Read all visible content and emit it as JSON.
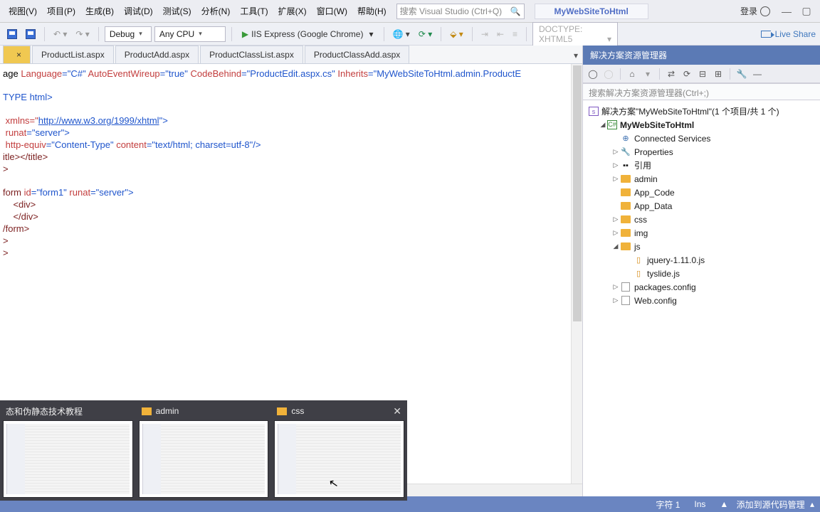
{
  "menu": {
    "view": "视图(V)",
    "project": "项目(P)",
    "build": "生成(B)",
    "debug": "调试(D)",
    "test": "测试(S)",
    "analyze": "分析(N)",
    "tools": "工具(T)",
    "extensions": "扩展(X)",
    "window": "窗口(W)",
    "help": "帮助(H)"
  },
  "search_placeholder": "搜索 Visual Studio (Ctrl+Q)",
  "project_title": "MyWebSiteToHtml",
  "login_label": "登录",
  "toolbar": {
    "config": "Debug",
    "platform": "Any CPU",
    "run": "IIS Express (Google Chrome)",
    "doctype": "DOCTYPE: XHTML5",
    "liveshare": "Live Share"
  },
  "tabs": {
    "t0": "",
    "t0x": "×",
    "t1": "ProductList.aspx",
    "t2": "ProductAdd.aspx",
    "t3": "ProductClassList.aspx",
    "t4": "ProductClassAdd.aspx"
  },
  "code_line1_a": "age ",
  "code_line1_b": "Language",
  "code_line1_c": "=\"C#\" ",
  "code_line1_d": "AutoEventWireup",
  "code_line1_e": "=\"true\" ",
  "code_line1_f": "CodeBehind",
  "code_line1_g": "=\"ProductEdit.aspx.cs\" ",
  "code_line1_h": "Inherits",
  "code_line1_i": "=\"MyWebSiteToHtml.admin.ProductE",
  "code_line3": "TYPE html>",
  "code_line5_a": " xmlns=\"",
  "code_line5_b": "http://www.w3.org/1999/xhtml",
  "code_line5_c": "\">",
  "code_line6_a": " runat",
  "code_line6_b": "=\"server\">",
  "code_line7_a": " http-equiv",
  "code_line7_b": "=\"Content-Type\" ",
  "code_line7_c": "content",
  "code_line7_d": "=\"text/html; charset=utf-8\"/>",
  "code_line8": "itle></title>",
  "code_line9": ">",
  "code_line11_a": "form ",
  "code_line11_b": "id",
  "code_line11_c": "=\"form1\" ",
  "code_line11_d": "runat",
  "code_line11_e": "=\"server\">",
  "code_line12": "    <div>",
  "code_line13": "    </div>",
  "code_line14": "/form>",
  "code_line15": ">",
  "code_line16": ">",
  "sol": {
    "title": "解决方案资源管理器",
    "search": "搜索解决方案资源管理器(Ctrl+;)",
    "root": "解决方案\"MyWebSiteToHtml\"(1 个项目/共 1 个)",
    "proj": "MyWebSiteToHtml",
    "conn": "Connected Services",
    "props": "Properties",
    "refs": "引用",
    "admin": "admin",
    "appcode": "App_Code",
    "appdata": "App_Data",
    "css": "css",
    "img": "img",
    "js": "js",
    "jq": "jquery-1.11.0.js",
    "ty": "tyslide.js",
    "pkg": "packages.config",
    "web": "Web.config"
  },
  "status": {
    "char": "字符 1",
    "ins": "Ins",
    "src": "添加到源代码管理",
    "arrow": "▲"
  },
  "taskbar": {
    "t1": "态和伪静态技术教程",
    "t2": "admin",
    "t3": "css"
  }
}
